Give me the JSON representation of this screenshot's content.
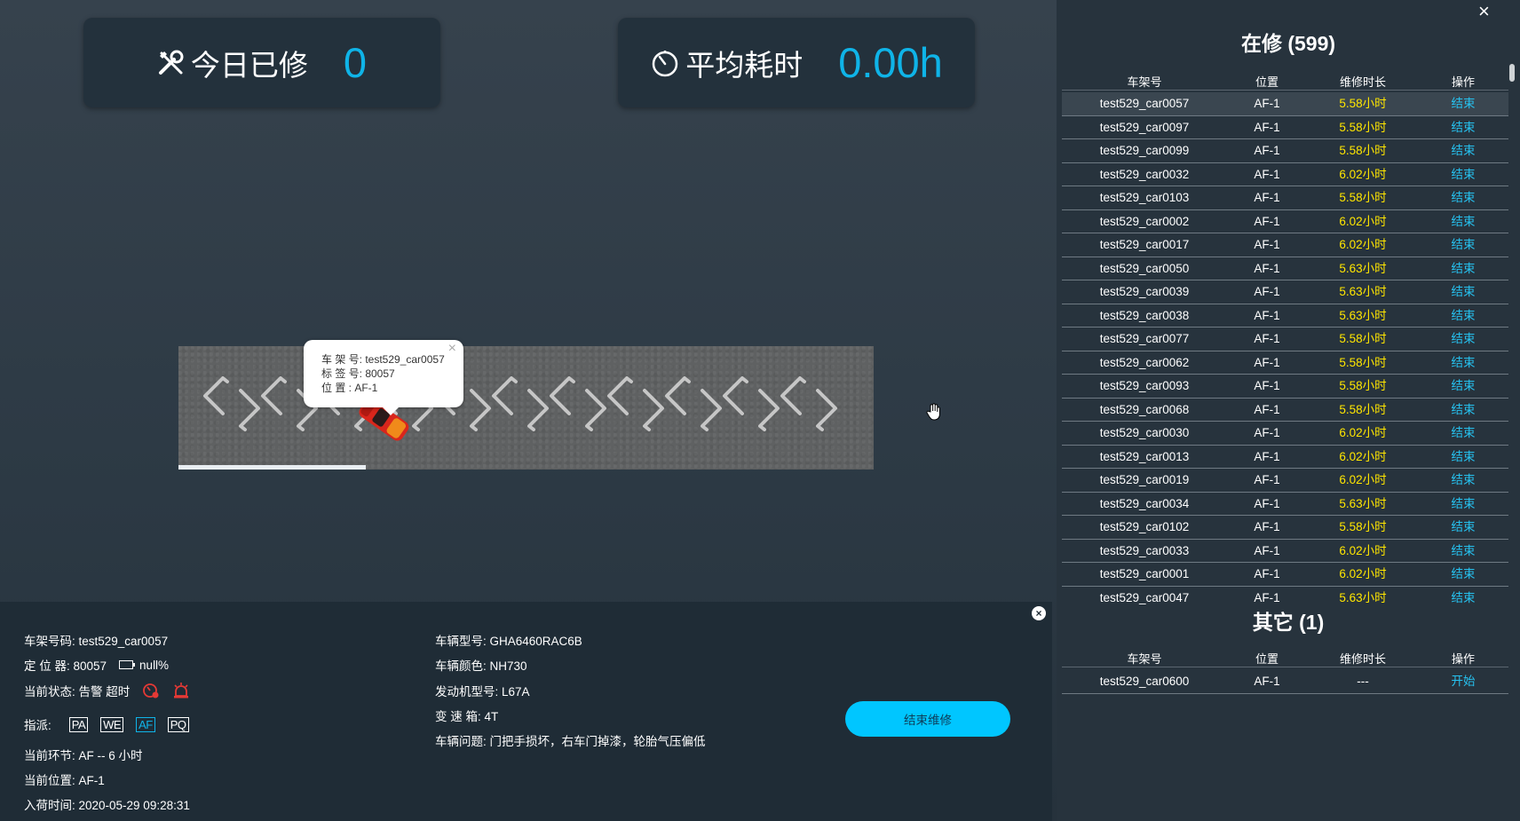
{
  "stats": {
    "repaired_today_label": "今日已修",
    "repaired_today_value": "0",
    "avg_time_label": "平均耗时",
    "avg_time_value": "0.00h"
  },
  "map": {
    "progress_fraction": 0.27
  },
  "popup": {
    "line1": "车 架 号: test529_car0057",
    "line2": "标 签 号: 80057",
    "line3": "位 置 : AF-1",
    "close": "×"
  },
  "details": {
    "frame_no": "车架号码: test529_car0057",
    "locator": "定 位 器: 80057",
    "battery": "null%",
    "status": "当前状态: 告警 超时",
    "assign_label": "指派:",
    "assign_tags": [
      "PA",
      "WE",
      "AF",
      "PQ"
    ],
    "current_step": "当前环节: AF -- 6 小时",
    "current_position": "当前位置: AF-1",
    "entry_time": "入荷时间: 2020-05-29 09:28:31",
    "model": "车辆型号: GHA6460RAC6B",
    "color": "车辆颜色: NH730",
    "engine": "发动机型号: L67A",
    "gearbox": "变 速 箱: 4T",
    "issues": "车辆问题: 门把手损坏，右车门掉漆，轮胎气压偏低",
    "finish_button": "结束维修",
    "close": "×"
  },
  "in_repair": {
    "title": "在修 (599)",
    "headers": [
      "车架号",
      "位置",
      "维修时长",
      "操作"
    ],
    "rows": [
      {
        "frame": "test529_car0057",
        "pos": "AF-1",
        "dur": "5.58小时",
        "act": "结束"
      },
      {
        "frame": "test529_car0097",
        "pos": "AF-1",
        "dur": "5.58小时",
        "act": "结束"
      },
      {
        "frame": "test529_car0099",
        "pos": "AF-1",
        "dur": "5.58小时",
        "act": "结束"
      },
      {
        "frame": "test529_car0032",
        "pos": "AF-1",
        "dur": "6.02小时",
        "act": "结束"
      },
      {
        "frame": "test529_car0103",
        "pos": "AF-1",
        "dur": "5.58小时",
        "act": "结束"
      },
      {
        "frame": "test529_car0002",
        "pos": "AF-1",
        "dur": "6.02小时",
        "act": "结束"
      },
      {
        "frame": "test529_car0017",
        "pos": "AF-1",
        "dur": "6.02小时",
        "act": "结束"
      },
      {
        "frame": "test529_car0050",
        "pos": "AF-1",
        "dur": "5.63小时",
        "act": "结束"
      },
      {
        "frame": "test529_car0039",
        "pos": "AF-1",
        "dur": "5.63小时",
        "act": "结束"
      },
      {
        "frame": "test529_car0038",
        "pos": "AF-1",
        "dur": "5.63小时",
        "act": "结束"
      },
      {
        "frame": "test529_car0077",
        "pos": "AF-1",
        "dur": "5.58小时",
        "act": "结束"
      },
      {
        "frame": "test529_car0062",
        "pos": "AF-1",
        "dur": "5.58小时",
        "act": "结束"
      },
      {
        "frame": "test529_car0093",
        "pos": "AF-1",
        "dur": "5.58小时",
        "act": "结束"
      },
      {
        "frame": "test529_car0068",
        "pos": "AF-1",
        "dur": "5.58小时",
        "act": "结束"
      },
      {
        "frame": "test529_car0030",
        "pos": "AF-1",
        "dur": "6.02小时",
        "act": "结束"
      },
      {
        "frame": "test529_car0013",
        "pos": "AF-1",
        "dur": "6.02小时",
        "act": "结束"
      },
      {
        "frame": "test529_car0019",
        "pos": "AF-1",
        "dur": "6.02小时",
        "act": "结束"
      },
      {
        "frame": "test529_car0034",
        "pos": "AF-1",
        "dur": "5.63小时",
        "act": "结束"
      },
      {
        "frame": "test529_car0102",
        "pos": "AF-1",
        "dur": "5.58小时",
        "act": "结束"
      },
      {
        "frame": "test529_car0033",
        "pos": "AF-1",
        "dur": "6.02小时",
        "act": "结束"
      },
      {
        "frame": "test529_car0001",
        "pos": "AF-1",
        "dur": "6.02小时",
        "act": "结束"
      },
      {
        "frame": "test529_car0047",
        "pos": "AF-1",
        "dur": "5.63小时",
        "act": "结束"
      }
    ]
  },
  "other": {
    "title": "其它 (1)",
    "headers": [
      "车架号",
      "位置",
      "维修时长",
      "操作"
    ],
    "rows": [
      {
        "frame": "test529_car0600",
        "pos": "AF-1",
        "dur": "---",
        "act": "开始"
      }
    ]
  },
  "side_close": "×"
}
